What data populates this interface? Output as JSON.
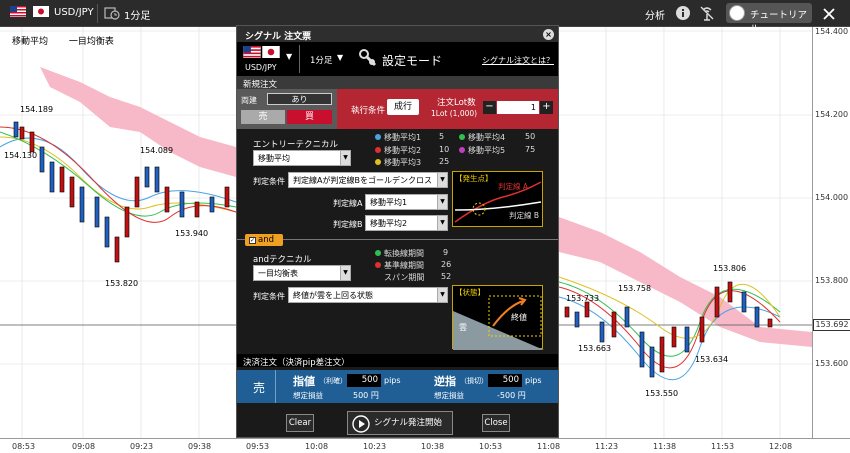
{
  "topbar": {
    "symbol": "USD/JPY",
    "timeframe": "1分足",
    "analysis": "分析",
    "tutorial": "チュートリアル"
  },
  "chart": {
    "legend": [
      "移動平均",
      "一目均衡表"
    ],
    "price_ticks": [
      "154.400",
      "154.200",
      "154.000",
      "153.800",
      "153.600"
    ],
    "current_price": "153.692",
    "time_ticks": [
      "08:53",
      "09:08",
      "09:23",
      "09:38",
      "09:53",
      "10:08",
      "10:23",
      "10:38",
      "10:53",
      "11:08",
      "11:23",
      "11:38",
      "11:53",
      "12:08"
    ],
    "annotations": [
      "154.189",
      "154.130",
      "154.089",
      "153.940",
      "153.820",
      "153.806",
      "153.733",
      "153.758",
      "153.663",
      "153.634",
      "153.550"
    ]
  },
  "modal": {
    "title": "シグナル 注文票",
    "symbol": "USD/JPY",
    "timeframe": "1分足",
    "mode": "設定モード",
    "help_link": "シグナル注文とは？",
    "new_order": "新規注文",
    "both_label": "両建",
    "both_value": "あり",
    "sell": "売",
    "buy": "買",
    "exec_cond": "執行条件",
    "exec_type": "成行",
    "lot_label": "注文Lot数",
    "lot_unit": "1Lot (1,000)",
    "lot_value": "1",
    "minus": "−",
    "plus": "+",
    "entry_tech_label": "エントリーテクニカル",
    "entry_tech": "移動平均",
    "ma": [
      {
        "name": "移動平均1",
        "value": "5",
        "color": "#4aa3e0"
      },
      {
        "name": "移動平均2",
        "value": "10",
        "color": "#e03030"
      },
      {
        "name": "移動平均3",
        "value": "25",
        "color": "#e0c020"
      },
      {
        "name": "移動平均4",
        "value": "50",
        "color": "#30c050"
      },
      {
        "name": "移動平均5",
        "value": "75",
        "color": "#c040c0"
      }
    ],
    "judge_label": "判定条件",
    "judge1": "判定線Aが判定線Bをゴールデンクロス",
    "lineA_label": "判定線A",
    "lineA": "移動平均1",
    "lineB_label": "判定線B",
    "lineB": "移動平均2",
    "graphic1_tag": "【発生点】",
    "graphic1_a": "判定線 A",
    "graphic1_b": "判定線 B",
    "and_label": "and",
    "and_tech_label": "andテクニカル",
    "and_tech": "一目均衡表",
    "ichimoku": [
      {
        "name": "転換線期間",
        "value": "9",
        "color": "#30c050"
      },
      {
        "name": "基準線期間",
        "value": "26",
        "color": "#e03030"
      },
      {
        "name": "スパン期間",
        "value": "52",
        "color": ""
      }
    ],
    "judge2": "終値が雲を上回る状態",
    "graphic2_tag": "【状態】",
    "graphic2_cloud": "雲",
    "graphic2_close": "終値",
    "settle_label": "決済注文（決済pip差注文）",
    "settle_side": "売",
    "limit_label": "指値",
    "limit_sub": "（利確）",
    "limit_pips": "500",
    "limit_unit": "pips",
    "limit_est_label": "想定損益",
    "limit_est": "500 円",
    "stop_label": "逆指",
    "stop_sub": "（損切）",
    "stop_pips": "500",
    "stop_unit": "pips",
    "stop_est_label": "想定損益",
    "stop_est": "-500 円",
    "clear": "Clear",
    "start": "シグナル発注開始",
    "close": "Close"
  },
  "colors": {
    "sell_blue": "#1f5f96",
    "buy_red": "#c8102e",
    "order_bar": "#b42632",
    "ichimoku_cloud": "#f7b8c8"
  }
}
